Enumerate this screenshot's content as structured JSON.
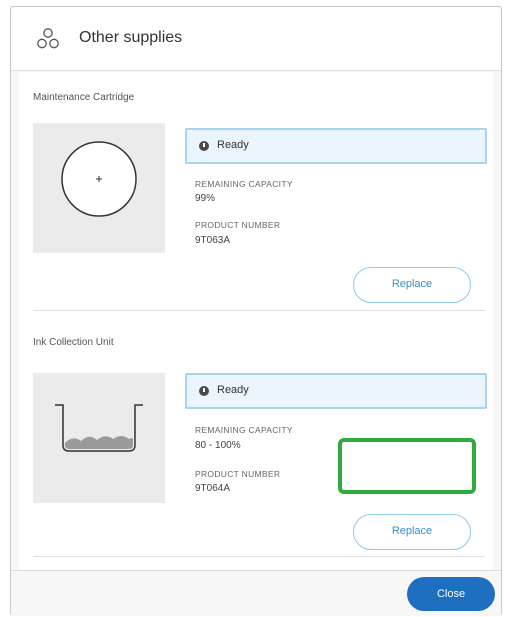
{
  "dialog": {
    "title": "Other supplies",
    "title_icon": "supplies-icon"
  },
  "supplies": [
    {
      "name": "Maintenance Cartridge",
      "status": "Ready",
      "remaining_label": "REMAINING CAPACITY",
      "remaining_value": "99%",
      "product_label": "PRODUCT NUMBER",
      "product_value": "9T063A",
      "replace_label": "Replace",
      "image_icon": "maintenance-cartridge-icon"
    },
    {
      "name": "Ink Collection Unit",
      "status": "Ready",
      "remaining_label": "REMAINING CAPACITY",
      "remaining_value": "80 - 100%",
      "product_label": "PRODUCT NUMBER",
      "product_value": "9T064A",
      "replace_label": "Replace",
      "image_icon": "ink-collection-unit-icon"
    }
  ],
  "footer": {
    "close_label": "Close"
  },
  "colors": {
    "accent": "#1f6fc0",
    "status_bg": "#eaf5fd",
    "status_border": "#a9d3ee",
    "highlight": "#2faa3f"
  }
}
